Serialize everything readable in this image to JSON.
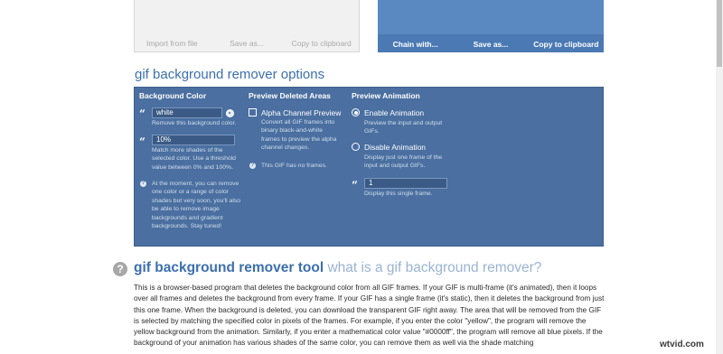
{
  "input_panel": {
    "actions": [
      "Import from file",
      "Save as...",
      "Copy to clipboard"
    ]
  },
  "output_panel": {
    "actions": [
      "Chain with...",
      "Save as...",
      "Copy to clipboard"
    ]
  },
  "options": {
    "title": "gif background remover options",
    "background_color": {
      "heading": "Background Color",
      "color_value": "white",
      "color_hint": "Remove this background color.",
      "threshold_value": "10%",
      "threshold_hint": "Match more shades of the selected color. Use a threshold value between 0% and 100%.",
      "note": "At the moment, you can remove one color or a range of color shades but very soon, you'll also be able to remove image backgrounds and gradient backgrounds. Stay tuned!"
    },
    "preview_deleted": {
      "heading": "Preview Deleted Areas",
      "checkbox_label": "Alpha Channel Preview",
      "checkbox_checked": false,
      "checkbox_hint": "Convert all GIF frames into binary black-and-white frames to preview the alpha channel changes.",
      "note": "This GIF has no frames."
    },
    "preview_animation": {
      "heading": "Preview Animation",
      "enable_label": "Enable Animation",
      "enable_hint": "Preview the input and output GIFs.",
      "disable_label": "Disable Animation",
      "disable_hint": "Display just one frame of the input and output GIFs.",
      "selected": "enable",
      "frame_value": "1",
      "frame_hint": "Display this single frame."
    }
  },
  "tool": {
    "title": "gif background remover tool",
    "subtitle": "what is a gif background remover?",
    "description": "This is a browser-based program that deletes the background color from all GIF frames. If your GIF is multi-frame (it's animated), then it loops over all frames and deletes the background from every frame. If your GIF has a single frame (it's static), then it deletes the background from just this one frame. When the background is deleted, you can download the transparent GIF right away. The area that will be removed from the GIF is selected by matching the specified color in pixels of the frames. For example, if you enter the color \"yellow\", the program will remove the yellow background from the animation. Similarly, if you enter a mathematical color value \"#0000ff\", the program will remove all blue pixels. If the background of your animation has various shades of the same color, you can remove them as well via the shade matching"
  },
  "watermark": "wtvid.com",
  "colors": {
    "accent": "#3c6fad",
    "panel": "#4a6fa0",
    "output_panel": "#4a79b3"
  }
}
